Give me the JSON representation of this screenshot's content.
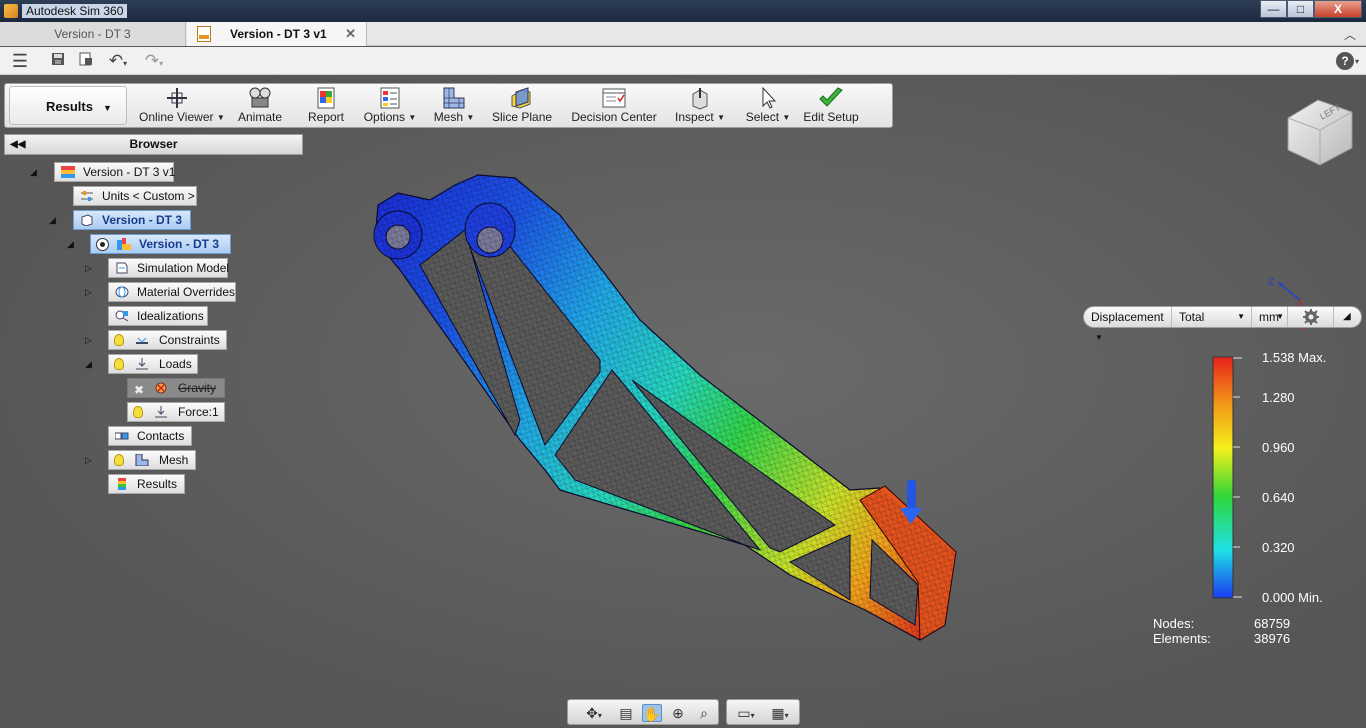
{
  "window": {
    "title": "Autodesk Sim 360",
    "controls": {
      "minimize": "—",
      "maximize": "□",
      "close": "X"
    }
  },
  "tabs": [
    {
      "label": "Version - DT 3",
      "active": false
    },
    {
      "label": "Version - DT 3 v1",
      "active": true,
      "close": "✕"
    }
  ],
  "ribbon": {
    "active_tab": "Results",
    "buttons": [
      {
        "label": "Online Viewer",
        "icon": "online-viewer-icon",
        "dropdown": true
      },
      {
        "label": "Animate",
        "icon": "animate-icon",
        "dropdown": false
      },
      {
        "label": "Report",
        "icon": "report-icon",
        "dropdown": false
      },
      {
        "label": "Options",
        "icon": "options-icon",
        "dropdown": true
      },
      {
        "label": "Mesh",
        "icon": "mesh-icon",
        "dropdown": true
      },
      {
        "label": "Slice Plane",
        "icon": "slice-plane-icon",
        "dropdown": false
      },
      {
        "label": "Decision Center",
        "icon": "decision-center-icon",
        "dropdown": false
      },
      {
        "label": "Inspect",
        "icon": "inspect-icon",
        "dropdown": true
      },
      {
        "label": "Select",
        "icon": "select-icon",
        "dropdown": true
      },
      {
        "label": "Edit Setup",
        "icon": "checkmark-icon",
        "dropdown": false
      }
    ]
  },
  "browser": {
    "title": "Browser",
    "nodes": {
      "root": "Version - DT 3 v1",
      "units": "Units < Custom >",
      "design": "Version - DT 3",
      "study": "Version - DT 3",
      "simulation_model": "Simulation Model",
      "material_overrides": "Material Overrides",
      "idealizations": "Idealizations",
      "constraints": "Constraints",
      "loads": "Loads",
      "gravity": "Gravity",
      "force": "Force:1",
      "contacts": "Contacts",
      "mesh": "Mesh",
      "results": "Results"
    }
  },
  "viewcube": {
    "face_label": "LEFT"
  },
  "triad": {
    "axis_label": "Z"
  },
  "legend_toolbar": {
    "result_type": "Displacement",
    "component": "Total",
    "units": "mm"
  },
  "legend": {
    "max_label": "1.538 Max.",
    "ticks": [
      "1.280",
      "0.960",
      "0.640",
      "0.320"
    ],
    "min_label": "0.000 Min.",
    "colors": [
      "#e8221b",
      "#f29a18",
      "#f4ef1a",
      "#2fd63a",
      "#20e0e6",
      "#1a3cf0"
    ]
  },
  "stats": {
    "nodes_label": "Nodes:",
    "nodes_value": "68759",
    "elements_label": "Elements:",
    "elements_value": "38976"
  }
}
